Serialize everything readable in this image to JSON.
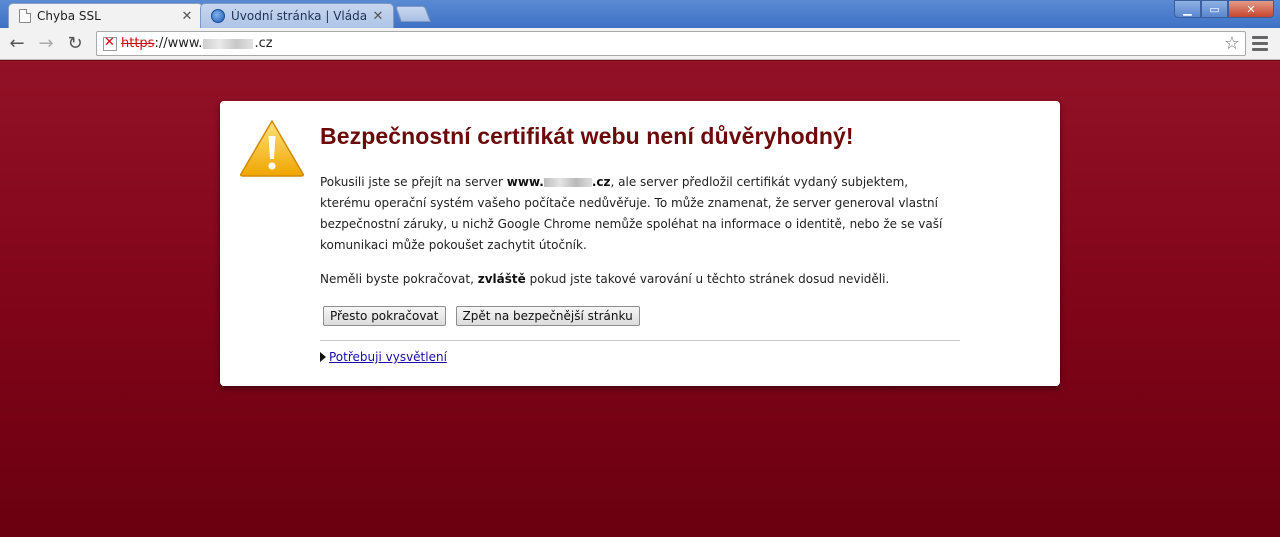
{
  "tabs": [
    {
      "title": "Chyba SSL",
      "icon": "page-icon",
      "active": true
    },
    {
      "title": "Úvodní stránka | Vláda ČR",
      "icon": "globe-icon",
      "active": false
    }
  ],
  "omnibox": {
    "scheme": "https",
    "rest_prefix": "://www.",
    "rest_suffix": ".cz"
  },
  "error": {
    "title": "Bezpečnostní certifikát webu není důvěryhodný!",
    "p1_a": "Pokusili jste se přejít na server ",
    "p1_server_prefix": "www.",
    "p1_server_suffix": ".cz",
    "p1_b": ", ale server předložil certifikát vydaný subjektem, kterému operační systém vašeho počítače nedůvěřuje. To může znamenat, že server generoval vlastní bezpečnostní záruky, u nichž Google Chrome nemůže spoléhat na informace o identitě, nebo že se vaší komunikaci může pokoušet zachytit útočník.",
    "p2_a": "Neměli byste pokračovat, ",
    "p2_bold": "zvláště",
    "p2_b": " pokud jste takové varování u těchto stránek dosud neviděli.",
    "proceed_button": "Přesto pokračovat",
    "back_button": "Zpět na bezpečnější stránku",
    "explain_link": "Potřebuji vysvětlení"
  },
  "colors": {
    "heading": "#6b0a0a",
    "background": "#7f0418",
    "link": "#1a0dab"
  }
}
